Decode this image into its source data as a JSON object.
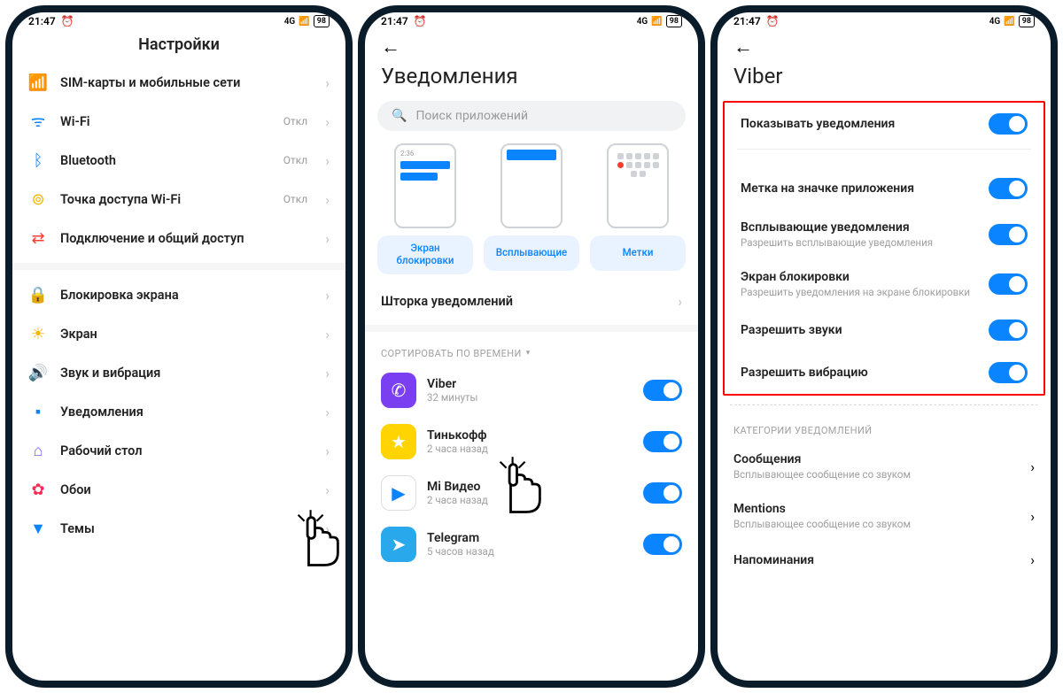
{
  "status": {
    "time": "21:47",
    "battery": "98",
    "signal": "4G"
  },
  "phone1": {
    "title": "Настройки",
    "groups": [
      [
        {
          "icon": "📶",
          "color": "#f7b500",
          "label": "SIM-карты и мобильные сети",
          "meta": ""
        },
        {
          "icon": "ᯤ",
          "color": "#0a84ff",
          "label": "Wi-Fi",
          "meta": "Откл"
        },
        {
          "icon": "ᛒ",
          "color": "#0a84ff",
          "label": "Bluetooth",
          "meta": "Откл"
        },
        {
          "icon": "⊚",
          "color": "#f7b500",
          "label": "Точка доступа Wi-Fi",
          "meta": "Откл"
        },
        {
          "icon": "⇄",
          "color": "#ff3b30",
          "label": "Подключение и общий доступ",
          "meta": ""
        }
      ],
      [
        {
          "icon": "🔒",
          "color": "#ff3b30",
          "label": "Блокировка экрана",
          "meta": ""
        },
        {
          "icon": "☀",
          "color": "#f7b500",
          "label": "Экран",
          "meta": ""
        },
        {
          "icon": "🔊",
          "color": "#34c759",
          "label": "Звук и вибрация",
          "meta": ""
        },
        {
          "icon": "▪",
          "color": "#0a84ff",
          "label": "Уведомления",
          "meta": ""
        },
        {
          "icon": "⌂",
          "color": "#7b61ff",
          "label": "Рабочий стол",
          "meta": ""
        },
        {
          "icon": "✿",
          "color": "#ff2d55",
          "label": "Обои",
          "meta": ""
        },
        {
          "icon": "▼",
          "color": "#0a84ff",
          "label": "Темы",
          "meta": ""
        }
      ]
    ]
  },
  "phone2": {
    "title": "Уведомления",
    "search_placeholder": "Поиск приложений",
    "preview_labels": [
      "Экран блокировки",
      "Всплывающие",
      "Метки"
    ],
    "shade_row": "Шторка уведомлений",
    "sort_label": "СОРТИРОВАТЬ ПО ВРЕМЕНИ",
    "apps": [
      {
        "name": "Viber",
        "sub": "32 минуты",
        "bg": "#7b3ff2",
        "glyph": "✆",
        "on": true
      },
      {
        "name": "Тинькофф",
        "sub": "2 часа назад",
        "bg": "#ffd400",
        "glyph": "★",
        "on": true
      },
      {
        "name": "Mi Видео",
        "sub": "2 часа назад",
        "bg": "#ffffff",
        "glyph": "▶",
        "on": true
      },
      {
        "name": "Telegram",
        "sub": "5 часов назад",
        "bg": "#29a9eb",
        "glyph": "➤",
        "on": true
      }
    ]
  },
  "phone3": {
    "title": "Viber",
    "switches": [
      {
        "title": "Показывать уведомления",
        "sub": "",
        "on": true
      },
      {
        "title": "Метка на значке приложения",
        "sub": "",
        "on": true
      },
      {
        "title": "Всплывающие уведомления",
        "sub": "Разрешить всплывающие уведомления",
        "on": true
      },
      {
        "title": "Экран блокировки",
        "sub": "Разрешить уведомления на экране блокировки",
        "on": true
      },
      {
        "title": "Разрешить звуки",
        "sub": "",
        "on": true
      },
      {
        "title": "Разрешить вибрацию",
        "sub": "",
        "on": true
      }
    ],
    "cat_label": "КАТЕГОРИИ УВЕДОМЛЕНИЙ",
    "categories": [
      {
        "title": "Сообщения",
        "sub": "Всплывающее сообщение со звуком"
      },
      {
        "title": "Mentions",
        "sub": "Всплывающее сообщение со звуком"
      },
      {
        "title": "Напоминания",
        "sub": ""
      }
    ]
  }
}
